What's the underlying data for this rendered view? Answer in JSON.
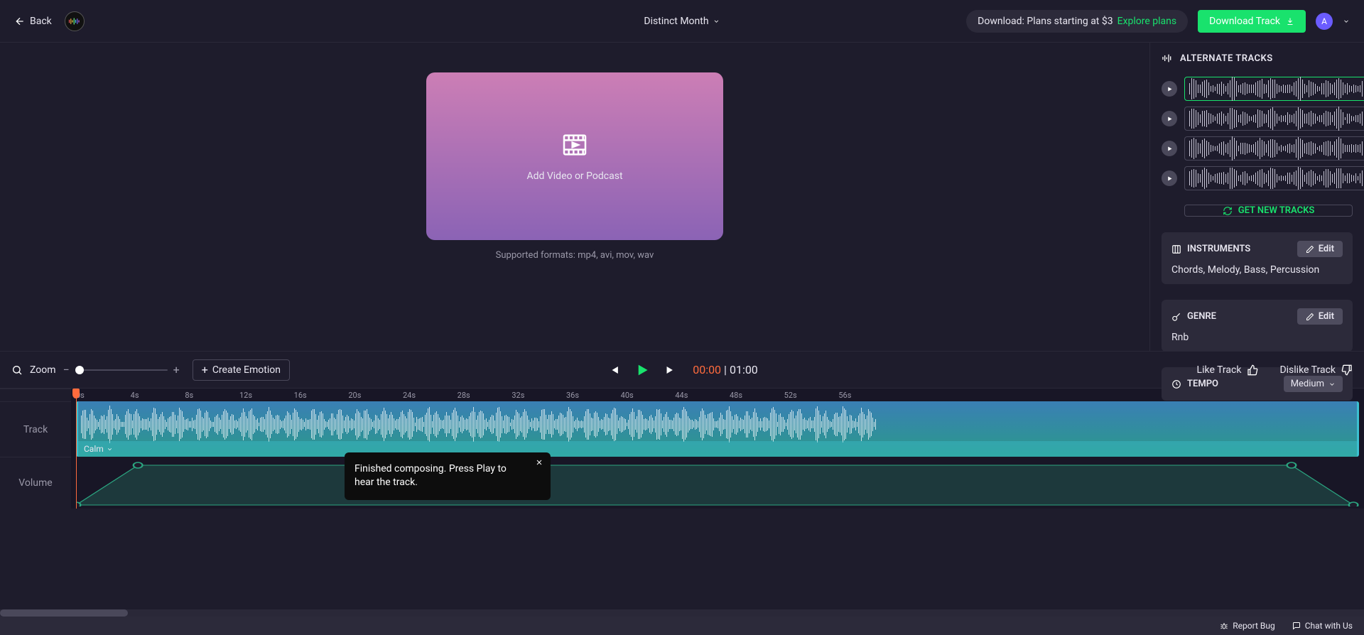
{
  "topbar": {
    "back_label": "Back",
    "title": "Distinct Month",
    "download_text": "Download: Plans starting at $3",
    "explore": "Explore plans",
    "download_btn": "Download Track",
    "avatar_letter": "A"
  },
  "upload": {
    "label": "Add Video or Podcast",
    "supported": "Supported formats: mp4, avi, mov, wav"
  },
  "alt": {
    "title": "ALTERNATE TRACKS",
    "get_new": "GET NEW TRACKS"
  },
  "instruments": {
    "title": "INSTRUMENTS",
    "edit": "Edit",
    "value": "Chords, Melody, Bass, Percussion"
  },
  "genre": {
    "title": "GENRE",
    "edit": "Edit",
    "value": "Rnb"
  },
  "tempo": {
    "title": "TEMPO",
    "value": "Medium"
  },
  "controls": {
    "zoom_label": "Zoom",
    "create_emotion": "Create Emotion",
    "current_time": "00:00",
    "sep": "|",
    "total_time": "01:00",
    "like": "Like Track",
    "dislike": "Dislike Track"
  },
  "timeline": {
    "track_label": "Track",
    "volume_label": "Volume",
    "clip_emotion": "Calm",
    "ticks": [
      "0s",
      "4s",
      "8s",
      "12s",
      "16s",
      "20s",
      "24s",
      "28s",
      "32s",
      "36s",
      "40s",
      "44s",
      "48s",
      "52s",
      "56s"
    ]
  },
  "toast": "Finished composing. Press Play to hear the track.",
  "bottom": {
    "report": "Report Bug",
    "chat": "Chat with Us"
  }
}
